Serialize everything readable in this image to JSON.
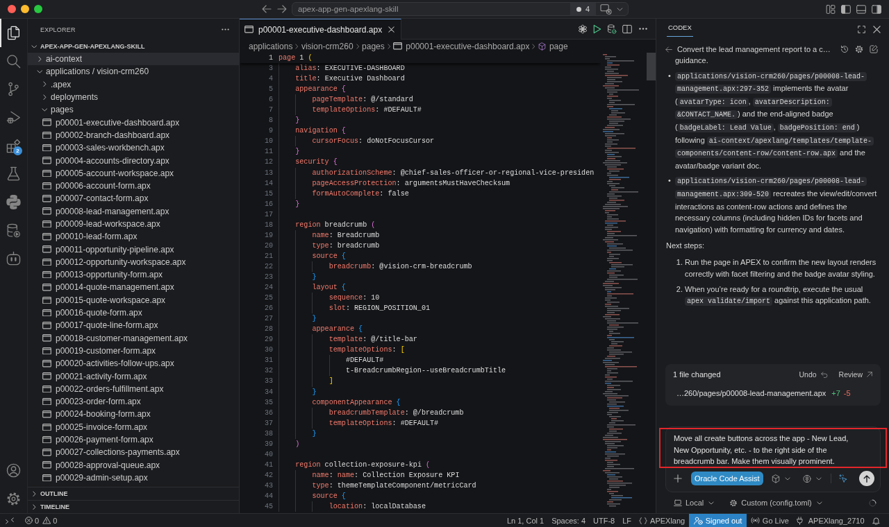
{
  "title_bar": {
    "command_center": {
      "label": "apex-app-gen-apexlang-skill",
      "count": "4"
    }
  },
  "activity_bar": {
    "top": [
      {
        "kind": "files",
        "selected": true
      },
      {
        "kind": "search",
        "selected": false
      },
      {
        "kind": "source-control",
        "selected": false
      },
      {
        "kind": "run-debug",
        "selected": false
      },
      {
        "kind": "extensions",
        "selected": false,
        "badge": "2"
      },
      {
        "kind": "testing",
        "selected": false
      },
      {
        "kind": "python",
        "selected": false
      },
      {
        "kind": "database",
        "selected": false
      },
      {
        "kind": "robot",
        "selected": false
      }
    ],
    "bottom": [
      {
        "kind": "account"
      },
      {
        "kind": "settings"
      }
    ]
  },
  "explorer": {
    "title": "EXPLORER",
    "root": {
      "label": "APEX-APP-GEN-APEXLANG-SKILL",
      "expanded": true,
      "children": [
        {
          "kind": "folder",
          "label": "ai-context",
          "expanded": false,
          "selected": true
        },
        {
          "kind": "folder",
          "label": "applications / vision-crm260",
          "expanded": true,
          "selected": false,
          "children": [
            {
              "kind": "folder",
              "label": ".apex",
              "expanded": false,
              "selected": false
            },
            {
              "kind": "folder",
              "label": "deployments",
              "expanded": false,
              "selected": false
            },
            {
              "kind": "folder",
              "label": "pages",
              "expanded": true,
              "selected": false,
              "children": [
                {
                  "kind": "file",
                  "label": "p00001-executive-dashboard.apx",
                  "selected": false
                },
                {
                  "kind": "file",
                  "label": "p00002-branch-dashboard.apx",
                  "selected": false
                },
                {
                  "kind": "file",
                  "label": "p00003-sales-workbench.apx",
                  "selected": false
                },
                {
                  "kind": "file",
                  "label": "p00004-accounts-directory.apx",
                  "selected": false
                },
                {
                  "kind": "file",
                  "label": "p00005-account-workspace.apx",
                  "selected": false
                },
                {
                  "kind": "file",
                  "label": "p00006-account-form.apx",
                  "selected": false
                },
                {
                  "kind": "file",
                  "label": "p00007-contact-form.apx",
                  "selected": false
                },
                {
                  "kind": "file",
                  "label": "p00008-lead-management.apx",
                  "selected": false
                },
                {
                  "kind": "file",
                  "label": "p00009-lead-workspace.apx",
                  "selected": false
                },
                {
                  "kind": "file",
                  "label": "p00010-lead-form.apx",
                  "selected": false
                },
                {
                  "kind": "file",
                  "label": "p00011-opportunity-pipeline.apx",
                  "selected": false
                },
                {
                  "kind": "file",
                  "label": "p00012-opportunity-workspace.apx",
                  "selected": false
                },
                {
                  "kind": "file",
                  "label": "p00013-opportunity-form.apx",
                  "selected": false
                },
                {
                  "kind": "file",
                  "label": "p00014-quote-management.apx",
                  "selected": false
                },
                {
                  "kind": "file",
                  "label": "p00015-quote-workspace.apx",
                  "selected": false
                },
                {
                  "kind": "file",
                  "label": "p00016-quote-form.apx",
                  "selected": false
                },
                {
                  "kind": "file",
                  "label": "p00017-quote-line-form.apx",
                  "selected": false
                },
                {
                  "kind": "file",
                  "label": "p00018-customer-management.apx",
                  "selected": false
                },
                {
                  "kind": "file",
                  "label": "p00019-customer-form.apx",
                  "selected": false
                },
                {
                  "kind": "file",
                  "label": "p00020-activities-follow-ups.apx",
                  "selected": false
                },
                {
                  "kind": "file",
                  "label": "p00021-activity-form.apx",
                  "selected": false
                },
                {
                  "kind": "file",
                  "label": "p00022-orders-fulfillment.apx",
                  "selected": false
                },
                {
                  "kind": "file",
                  "label": "p00023-order-form.apx",
                  "selected": false
                },
                {
                  "kind": "file",
                  "label": "p00024-booking-form.apx",
                  "selected": false
                },
                {
                  "kind": "file",
                  "label": "p00025-invoice-form.apx",
                  "selected": false
                },
                {
                  "kind": "file",
                  "label": "p00026-payment-form.apx",
                  "selected": false
                },
                {
                  "kind": "file",
                  "label": "p00027-collections-payments.apx",
                  "selected": false
                },
                {
                  "kind": "file",
                  "label": "p00028-approval-queue.apx",
                  "selected": false
                },
                {
                  "kind": "file",
                  "label": "p00029-admin-setup.apx",
                  "selected": false
                }
              ]
            }
          ]
        }
      ]
    },
    "sections": [
      {
        "label": "OUTLINE",
        "expanded": false
      },
      {
        "label": "TIMELINE",
        "expanded": false
      }
    ]
  },
  "editor": {
    "tabs": [
      {
        "label": "p00001-executive-dashboard.apx",
        "selected": true
      }
    ],
    "breadcrumb": [
      {
        "kind": "folder",
        "label": "applications"
      },
      {
        "kind": "folder",
        "label": "vision-crm260"
      },
      {
        "kind": "folder",
        "label": "pages"
      },
      {
        "kind": "file",
        "label": "p00001-executive-dashboard.apx"
      },
      {
        "kind": "symbol",
        "label": "page"
      }
    ],
    "code": {
      "number": "1",
      "tokens": [
        {
          "kind": "key",
          "text": "page"
        },
        {
          "kind": "plain",
          "text": " 1"
        },
        {
          "kind": "bracket",
          "text": " ("
        }
      ],
      "children": [
        {
          "number": "3",
          "tokens": [
            {
              "kind": "key",
              "text": "alias"
            },
            {
              "kind": "plain",
              "text": ": EXECUTIVE-DASHBOARD"
            }
          ]
        },
        {
          "number": "4",
          "tokens": [
            {
              "kind": "key",
              "text": "title"
            },
            {
              "kind": "plain",
              "text": ": Executive Dashboard"
            }
          ]
        },
        {
          "number": "5",
          "tokens": [
            {
              "kind": "key",
              "text": "appearance"
            },
            {
              "kind": "bracket",
              "text": " {"
            }
          ],
          "children": [
            {
              "number": "6",
              "tokens": [
                {
                  "kind": "key",
                  "text": "pageTemplate"
                },
                {
                  "kind": "plain",
                  "text": ": @/standard"
                }
              ]
            },
            {
              "number": "7",
              "tokens": [
                {
                  "kind": "key",
                  "text": "templateOptions"
                },
                {
                  "kind": "plain",
                  "text": ": #DEFAULT#"
                }
              ]
            }
          ]
        },
        {
          "number": "8",
          "tokens": [
            {
              "kind": "bracket",
              "text": "}"
            }
          ]
        },
        {
          "number": "9",
          "tokens": [
            {
              "kind": "key",
              "text": "navigation"
            },
            {
              "kind": "bracket",
              "text": " {"
            }
          ],
          "children": [
            {
              "number": "10",
              "tokens": [
                {
                  "kind": "key",
                  "text": "cursorFocus"
                },
                {
                  "kind": "plain",
                  "text": ": doNotFocusCursor"
                }
              ]
            }
          ]
        },
        {
          "number": "11",
          "tokens": [
            {
              "kind": "bracket",
              "text": "}"
            }
          ]
        },
        {
          "number": "12",
          "tokens": [
            {
              "kind": "key",
              "text": "security"
            },
            {
              "kind": "bracket",
              "text": " {"
            }
          ],
          "children": [
            {
              "number": "13",
              "tokens": [
                {
                  "kind": "key",
                  "text": "authorizationScheme"
                },
                {
                  "kind": "plain",
                  "text": ": @chief-sales-officer-or-regional-vice-presiden"
                }
              ]
            },
            {
              "number": "14",
              "tokens": [
                {
                  "kind": "key",
                  "text": "pageAccessProtection"
                },
                {
                  "kind": "plain",
                  "text": ": argumentsMustHaveChecksum"
                }
              ]
            },
            {
              "number": "15",
              "tokens": [
                {
                  "kind": "key",
                  "text": "formAutoComplete"
                },
                {
                  "kind": "plain",
                  "text": ": false"
                }
              ]
            }
          ]
        },
        {
          "number": "16",
          "tokens": [
            {
              "kind": "bracket",
              "text": "}"
            }
          ]
        },
        {
          "number": "17"
        },
        {
          "number": "18",
          "tokens": [
            {
              "kind": "key",
              "text": "region"
            },
            {
              "kind": "plain",
              "text": " breadcrumb"
            },
            {
              "kind": "bracket",
              "text": " ("
            }
          ],
          "children": [
            {
              "number": "19",
              "tokens": [
                {
                  "kind": "key",
                  "text": "name"
                },
                {
                  "kind": "plain",
                  "text": ": Breadcrumb"
                }
              ]
            },
            {
              "number": "20",
              "tokens": [
                {
                  "kind": "key",
                  "text": "type"
                },
                {
                  "kind": "plain",
                  "text": ": breadcrumb"
                }
              ]
            },
            {
              "number": "21",
              "tokens": [
                {
                  "kind": "key",
                  "text": "source"
                },
                {
                  "kind": "bracket",
                  "text": " {"
                }
              ],
              "children": [
                {
                  "number": "22",
                  "tokens": [
                    {
                      "kind": "key",
                      "text": "breadcrumb"
                    },
                    {
                      "kind": "plain",
                      "text": ": @vision-crm-breadcrumb"
                    }
                  ]
                }
              ]
            },
            {
              "number": "23",
              "tokens": [
                {
                  "kind": "bracket",
                  "text": "}"
                }
              ]
            },
            {
              "number": "24",
              "tokens": [
                {
                  "kind": "key",
                  "text": "layout"
                },
                {
                  "kind": "bracket",
                  "text": " {"
                }
              ],
              "children": [
                {
                  "number": "25",
                  "tokens": [
                    {
                      "kind": "key",
                      "text": "sequence"
                    },
                    {
                      "kind": "plain",
                      "text": ": 10"
                    }
                  ]
                },
                {
                  "number": "26",
                  "tokens": [
                    {
                      "kind": "key",
                      "text": "slot"
                    },
                    {
                      "kind": "plain",
                      "text": ": REGION_POSITION_01"
                    }
                  ]
                }
              ]
            },
            {
              "number": "27",
              "tokens": [
                {
                  "kind": "bracket",
                  "text": "}"
                }
              ]
            },
            {
              "number": "28",
              "tokens": [
                {
                  "kind": "key",
                  "text": "appearance"
                },
                {
                  "kind": "bracket",
                  "text": " {"
                }
              ],
              "children": [
                {
                  "number": "29",
                  "tokens": [
                    {
                      "kind": "key",
                      "text": "template"
                    },
                    {
                      "kind": "plain",
                      "text": ": @/title-bar"
                    }
                  ]
                },
                {
                  "number": "30",
                  "tokens": [
                    {
                      "kind": "key",
                      "text": "templateOptions"
                    },
                    {
                      "kind": "plain",
                      "text": ":"
                    },
                    {
                      "kind": "bracket",
                      "text": " ["
                    }
                  ],
                  "children": [
                    {
                      "number": "31",
                      "tokens": [
                        {
                          "kind": "plain",
                          "text": "#DEFAULT#"
                        }
                      ]
                    },
                    {
                      "number": "32",
                      "tokens": [
                        {
                          "kind": "plain",
                          "text": "t-BreadcrumbRegion--useBreadcrumbTitle"
                        }
                      ]
                    }
                  ]
                },
                {
                  "number": "33",
                  "tokens": [
                    {
                      "kind": "bracket",
                      "text": "]"
                    }
                  ]
                }
              ]
            },
            {
              "number": "34",
              "tokens": [
                {
                  "kind": "bracket",
                  "text": "}"
                }
              ]
            },
            {
              "number": "35",
              "tokens": [
                {
                  "kind": "key",
                  "text": "componentAppearance"
                },
                {
                  "kind": "bracket",
                  "text": " {"
                }
              ],
              "children": [
                {
                  "number": "36",
                  "tokens": [
                    {
                      "kind": "key",
                      "text": "breadcrumbTemplate"
                    },
                    {
                      "kind": "plain",
                      "text": ": @/breadcrumb"
                    }
                  ]
                },
                {
                  "number": "37",
                  "tokens": [
                    {
                      "kind": "key",
                      "text": "templateOptions"
                    },
                    {
                      "kind": "plain",
                      "text": ": #DEFAULT#"
                    }
                  ]
                }
              ]
            },
            {
              "number": "38",
              "tokens": [
                {
                  "kind": "bracket",
                  "text": "}"
                }
              ]
            }
          ]
        },
        {
          "number": "39",
          "tokens": [
            {
              "kind": "bracket",
              "text": ")"
            }
          ]
        },
        {
          "number": "40"
        },
        {
          "number": "41",
          "tokens": [
            {
              "kind": "key",
              "text": "region"
            },
            {
              "kind": "plain",
              "text": " collection-exposure-kpi"
            },
            {
              "kind": "bracket",
              "text": " ("
            }
          ],
          "children": [
            {
              "number": "42",
              "tokens": [
                {
                  "kind": "key",
                  "text": "name"
                },
                {
                  "kind": "plain",
                  "text": ": "
                },
                {
                  "kind": "key",
                  "text": "name"
                },
                {
                  "kind": "plain",
                  "text": ": Collection Exposure KPI"
                }
              ]
            },
            {
              "number": "43",
              "tokens": [
                {
                  "kind": "key",
                  "text": "type"
                },
                {
                  "kind": "plain",
                  "text": ": themeTemplateComponent/metricCard"
                }
              ]
            },
            {
              "number": "44",
              "tokens": [
                {
                  "kind": "key",
                  "text": "source"
                },
                {
                  "kind": "bracket",
                  "text": " {"
                }
              ],
              "children": [
                {
                  "number": "45",
                  "tokens": [
                    {
                      "kind": "key",
                      "text": "location"
                    },
                    {
                      "kind": "plain",
                      "text": ": localDatabase"
                    }
                  ]
                }
              ]
            }
          ]
        }
      ]
    }
  },
  "codex": {
    "tabs": [
      {
        "label": "CODEX",
        "selected": true
      }
    ],
    "thread_title": "Convert the lead management report to a c…",
    "messages": [
      {
        "kind": "bullets",
        "items": [
          {
            "segments": [
              {
                "kind": "text",
                "text": "guidance."
              }
            ]
          },
          {
            "marker": "•",
            "segments": [
              {
                "kind": "code",
                "text": "applications/vision-crm260/pages/p00008-lead-management.apx:297-352"
              },
              {
                "kind": "text",
                "text": " implements the avatar ("
              },
              {
                "kind": "code",
                "text": "avatarType: icon"
              },
              {
                "kind": "text",
                "text": ", "
              },
              {
                "kind": "code",
                "text": "avatarDescription: &CONTACT_NAME."
              },
              {
                "kind": "text",
                "text": ") and the end-aligned badge ("
              },
              {
                "kind": "code",
                "text": "badgeLabel: Lead Value"
              },
              {
                "kind": "text",
                "text": ", "
              },
              {
                "kind": "code",
                "text": "badgePosition: end"
              },
              {
                "kind": "text",
                "text": ") following "
              },
              {
                "kind": "code",
                "text": "ai-context/apexlang/templates/template-components/content-row/content-row.apx"
              },
              {
                "kind": "text",
                "text": " and the avatar/badge variant doc."
              }
            ]
          },
          {
            "marker": "•",
            "segments": [
              {
                "kind": "code",
                "text": "applications/vision-crm260/pages/p00008-lead-management.apx:309-520"
              },
              {
                "kind": "text",
                "text": " recreates the view/edit/convert interactions as content-row actions and defines the necessary columns (including hidden IDs for facets and navigation) with formatting for currency and dates."
              }
            ]
          }
        ]
      },
      {
        "kind": "paragraph",
        "segments": [
          {
            "kind": "text",
            "text": "Next steps:"
          }
        ]
      },
      {
        "kind": "numbered",
        "items": [
          {
            "marker": "1.",
            "segments": [
              {
                "kind": "text",
                "text": "Run the page in APEX to confirm the new layout renders correctly with facet filtering and the badge avatar styling."
              }
            ]
          },
          {
            "marker": "2.",
            "segments": [
              {
                "kind": "text",
                "text": "When you’re ready for a roundtrip, execute the usual "
              },
              {
                "kind": "code",
                "text": "apex validate/import"
              },
              {
                "kind": "text",
                "text": " against this application path."
              }
            ]
          }
        ]
      }
    ],
    "changes": {
      "title": "1 file changed",
      "actions": [
        {
          "kind": "undo",
          "label": "Undo"
        },
        {
          "kind": "review",
          "label": "Review"
        }
      ],
      "files": [
        {
          "path": "…260/pages/p00008-lead-management.apx",
          "added": "+7",
          "removed": "-5"
        }
      ]
    },
    "composer": {
      "value": "Move all create buttons across the app - New Lead, New Opportunity, etc. - to the right side of the breadcrumb bar. Make them visually prominent.",
      "highlighted": true,
      "mode": "Oracle Code Assist"
    },
    "footer": [
      {
        "kind": "laptop",
        "label": "Local"
      },
      {
        "kind": "gear",
        "label": "Custom (config.toml)"
      }
    ]
  },
  "status_bar": {
    "left": [
      {
        "kind": "remote"
      },
      {
        "kind": "problems",
        "errors": "0",
        "warnings": "0"
      }
    ],
    "right": [
      {
        "kind": "text",
        "label": "Ln 1, Col 1"
      },
      {
        "kind": "text",
        "label": "Spaces: 4"
      },
      {
        "kind": "text",
        "label": "UTF-8"
      },
      {
        "kind": "text",
        "label": "LF"
      },
      {
        "kind": "language",
        "label": "APEXlang"
      },
      {
        "kind": "account",
        "label": "Signed out"
      },
      {
        "kind": "broadcast",
        "label": "Go Live"
      },
      {
        "kind": "plug",
        "label": "APEXlang_2710"
      },
      {
        "kind": "bell"
      }
    ]
  }
}
